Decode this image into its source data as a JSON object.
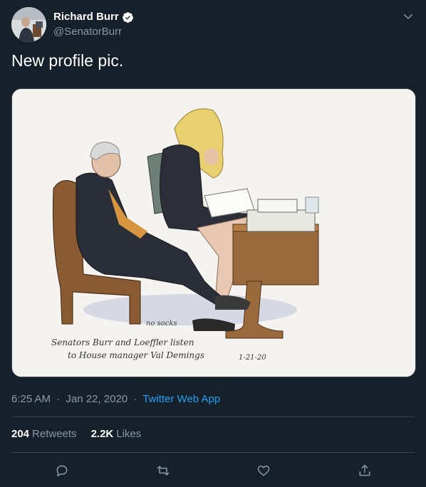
{
  "user": {
    "display_name": "Richard Burr",
    "handle": "@SenatorBurr"
  },
  "tweet": {
    "text": "New profile pic.",
    "media_caption_lines": [
      "Senators Burr and Loeffler listen",
      "to House manager Val Demings"
    ],
    "media_date": "1-21-20",
    "media_note": "no socks"
  },
  "meta": {
    "time": "6:25 AM",
    "separator": "·",
    "date": "Jan 22, 2020",
    "source": "Twitter Web App"
  },
  "stats": {
    "retweets_count": "204",
    "retweets_label": "Retweets",
    "likes_count": "2.2K",
    "likes_label": "Likes"
  },
  "icons": {
    "verified": "verified-badge-icon",
    "menu": "chevron-down-icon",
    "reply": "reply-icon",
    "retweet": "retweet-icon",
    "like": "heart-icon",
    "share": "share-icon"
  },
  "colors": {
    "background": "#15202b",
    "border": "#38444d",
    "muted": "#8899a6",
    "accent": "#1da1f2"
  }
}
